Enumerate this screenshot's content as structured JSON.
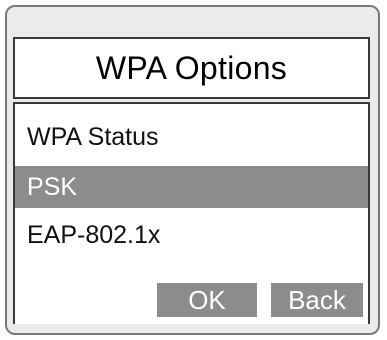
{
  "dialog": {
    "title": "WPA Options"
  },
  "menu": {
    "items": [
      {
        "label": "WPA Status",
        "selected": false
      },
      {
        "label": "PSK",
        "selected": true
      },
      {
        "label": "EAP-802.1x",
        "selected": false
      }
    ]
  },
  "buttons": {
    "ok_label": "OK",
    "back_label": "Back"
  },
  "colors": {
    "selection_bg": "#8c8c8c",
    "frame_bg": "#ebebeb",
    "border": "#3a3a3a"
  }
}
